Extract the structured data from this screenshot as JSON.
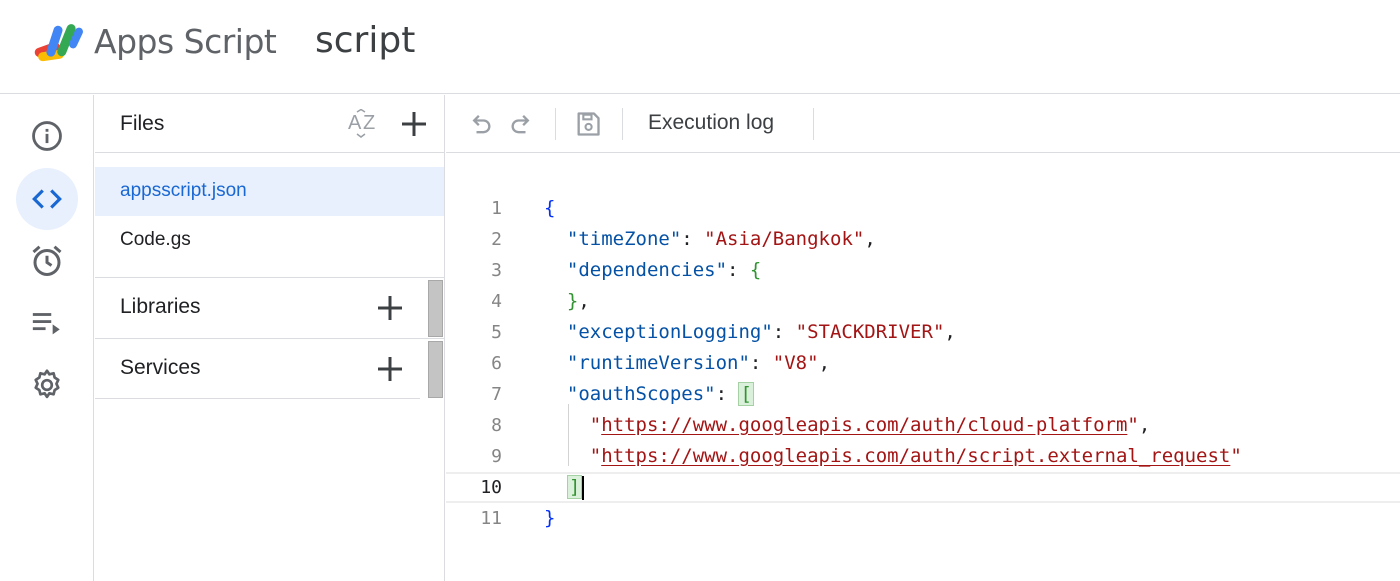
{
  "header": {
    "app_name": "Apps Script",
    "project_name": "script",
    "logo_icon": "apps-script-logo"
  },
  "rail": {
    "items": [
      {
        "name": "overview",
        "icon": "info-icon",
        "active": false
      },
      {
        "name": "editor",
        "icon": "code-icon",
        "active": true
      },
      {
        "name": "triggers",
        "icon": "alarm-clock-icon",
        "active": false
      },
      {
        "name": "executions",
        "icon": "playlist-play-icon",
        "active": false
      },
      {
        "name": "project-settings",
        "icon": "gear-icon",
        "active": false
      }
    ]
  },
  "files": {
    "title": "Files",
    "sort_icon": "sort-az-icon",
    "add_icon": "plus-icon",
    "items": [
      {
        "label": "appsscript.json",
        "selected": true
      },
      {
        "label": "Code.gs",
        "selected": false
      }
    ]
  },
  "libraries": {
    "title": "Libraries",
    "add_icon": "plus-icon"
  },
  "services": {
    "title": "Services",
    "add_icon": "plus-icon"
  },
  "toolbar": {
    "undo_icon": "undo-icon",
    "redo_icon": "redo-icon",
    "save_icon": "save-icon",
    "execution_log_label": "Execution log"
  },
  "editor": {
    "current_line": 10,
    "lines": [
      {
        "n": "1",
        "parts": [
          {
            "t": "{",
            "c": "tok-bracket"
          }
        ]
      },
      {
        "n": "2",
        "parts": [
          {
            "t": "  \"timeZone\"",
            "c": "tok-key"
          },
          {
            "t": ": ",
            "c": "tok-punc"
          },
          {
            "t": "\"Asia/Bangkok\"",
            "c": "tok-str"
          },
          {
            "t": ",",
            "c": "tok-punc"
          }
        ]
      },
      {
        "n": "3",
        "parts": [
          {
            "t": "  \"dependencies\"",
            "c": "tok-key"
          },
          {
            "t": ": ",
            "c": "tok-punc"
          },
          {
            "t": "{",
            "c": "tok-brace2"
          }
        ]
      },
      {
        "n": "4",
        "parts": [
          {
            "t": "  }",
            "c": "tok-brace2"
          },
          {
            "t": ",",
            "c": "tok-punc"
          }
        ]
      },
      {
        "n": "5",
        "parts": [
          {
            "t": "  \"exceptionLogging\"",
            "c": "tok-key"
          },
          {
            "t": ": ",
            "c": "tok-punc"
          },
          {
            "t": "\"STACKDRIVER\"",
            "c": "tok-str"
          },
          {
            "t": ",",
            "c": "tok-punc"
          }
        ]
      },
      {
        "n": "6",
        "parts": [
          {
            "t": "  \"runtimeVersion\"",
            "c": "tok-key"
          },
          {
            "t": ": ",
            "c": "tok-punc"
          },
          {
            "t": "\"V8\"",
            "c": "tok-str"
          },
          {
            "t": ",",
            "c": "tok-punc"
          }
        ]
      },
      {
        "n": "7",
        "parts": [
          {
            "t": "  \"oauthScopes\"",
            "c": "tok-key"
          },
          {
            "t": ": ",
            "c": "tok-punc"
          },
          {
            "t": "[",
            "c": "tok-bm"
          }
        ]
      },
      {
        "n": "8",
        "parts": [
          {
            "t": "    \"",
            "c": "tok-str"
          },
          {
            "t": "https://www.googleapis.com/auth/cloud-platform",
            "c": "tok-link"
          },
          {
            "t": "\"",
            "c": "tok-str"
          },
          {
            "t": ",",
            "c": "tok-punc"
          }
        ]
      },
      {
        "n": "9",
        "parts": [
          {
            "t": "    \"",
            "c": "tok-str"
          },
          {
            "t": "https://www.googleapis.com/auth/script.external_request",
            "c": "tok-link"
          },
          {
            "t": "\"",
            "c": "tok-str"
          }
        ]
      },
      {
        "n": "10",
        "parts": [
          {
            "t": "  ",
            "c": "tok-punc"
          },
          {
            "t": "]",
            "c": "tok-bm"
          }
        ]
      },
      {
        "n": "11",
        "parts": [
          {
            "t": "}",
            "c": "tok-bracket"
          }
        ]
      }
    ]
  },
  "colors": {
    "accent": "#1967d2",
    "selected_bg": "#e8f0fe",
    "key": "#0451a5",
    "string": "#a31515",
    "bracket": "#0431fa",
    "bracket2": "#319331"
  }
}
